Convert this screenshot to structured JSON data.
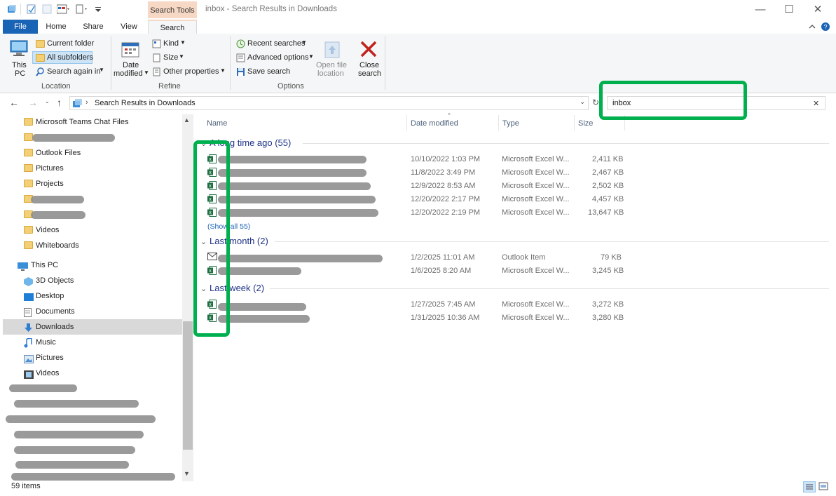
{
  "window": {
    "title": "inbox - Search Results in Downloads",
    "context_tab": "Search Tools",
    "controls": {
      "minimize": "—",
      "maximize": "☐",
      "close": "✕"
    }
  },
  "tabs": [
    "File",
    "Home",
    "Share",
    "View",
    "Search"
  ],
  "ribbon": {
    "location": {
      "this_pc_line1": "This",
      "this_pc_line2": "PC",
      "current_folder": "Current folder",
      "all_subfolders": "All subfolders",
      "search_again": "Search again in",
      "label": "Location"
    },
    "refine": {
      "date_line1": "Date",
      "date_line2": "modified",
      "kind": "Kind",
      "size": "Size",
      "other": "Other properties",
      "label": "Refine"
    },
    "options": {
      "recent": "Recent searches",
      "advanced": "Advanced options",
      "save": "Save search",
      "open_line1": "Open file",
      "open_line2": "location",
      "close_line1": "Close",
      "close_line2": "search",
      "label": "Options"
    }
  },
  "address": {
    "path": "Search Results in Downloads",
    "search_value": "inbox"
  },
  "nav": {
    "items": [
      {
        "label": "Microsoft Teams Chat Files",
        "icon": "folder-icon"
      },
      {
        "label": "",
        "icon": "folder-icon"
      },
      {
        "label": "Outlook Files",
        "icon": "folder-icon"
      },
      {
        "label": "Pictures",
        "icon": "folder-icon"
      },
      {
        "label": "Projects",
        "icon": "folder-icon"
      },
      {
        "label": "",
        "icon": "shared-folder-icon"
      },
      {
        "label": "",
        "icon": "shared-folder-icon"
      },
      {
        "label": "Videos",
        "icon": "folder-icon"
      },
      {
        "label": "Whiteboards",
        "icon": "folder-icon"
      }
    ],
    "this_pc": "This PC",
    "pc_items": [
      {
        "label": "3D Objects",
        "icon": "3d-objects-icon"
      },
      {
        "label": "Desktop",
        "icon": "desktop-icon"
      },
      {
        "label": "Documents",
        "icon": "documents-icon"
      },
      {
        "label": "Downloads",
        "icon": "downloads-icon"
      },
      {
        "label": "Music",
        "icon": "music-icon"
      },
      {
        "label": "Pictures",
        "icon": "pictures-icon"
      },
      {
        "label": "Videos",
        "icon": "videos-icon"
      }
    ]
  },
  "columns": {
    "name": "Name",
    "date": "Date modified",
    "type": "Type",
    "size": "Size"
  },
  "groups": [
    {
      "title": "A long time ago (55)",
      "show_all": "(Show all 55)",
      "rows": [
        {
          "date": "10/10/2022 1:03 PM",
          "type": "Microsoft Excel W...",
          "size": "2,411 KB",
          "icon": "excel-icon"
        },
        {
          "date": "11/8/2022 3:49 PM",
          "type": "Microsoft Excel W...",
          "size": "2,467 KB",
          "icon": "excel-icon"
        },
        {
          "date": "12/9/2022 8:53 AM",
          "type": "Microsoft Excel W...",
          "size": "2,502 KB",
          "icon": "excel-icon"
        },
        {
          "date": "12/20/2022 2:17 PM",
          "type": "Microsoft Excel W...",
          "size": "4,457 KB",
          "icon": "excel-icon"
        },
        {
          "date": "12/20/2022 2:19 PM",
          "type": "Microsoft Excel W...",
          "size": "13,647 KB",
          "icon": "excel-icon"
        }
      ]
    },
    {
      "title": "Last month (2)",
      "rows": [
        {
          "date": "1/2/2025 11:01 AM",
          "type": "Outlook Item",
          "size": "79 KB",
          "icon": "mail-icon"
        },
        {
          "date": "1/6/2025 8:20 AM",
          "type": "Microsoft Excel W...",
          "size": "3,245 KB",
          "icon": "excel-icon"
        }
      ]
    },
    {
      "title": "Last week (2)",
      "rows": [
        {
          "date": "1/27/2025 7:45 AM",
          "type": "Microsoft Excel W...",
          "size": "3,272 KB",
          "icon": "excel-icon"
        },
        {
          "date": "1/31/2025 10:36 AM",
          "type": "Microsoft Excel W...",
          "size": "3,280 KB",
          "icon": "excel-icon"
        }
      ]
    }
  ],
  "status": {
    "count": "59 items"
  },
  "colors": {
    "file_tab": "#1a64b5",
    "context_tab": "#f7d8c4",
    "group_text": "#1e3287",
    "highlight": "#00b04f",
    "selected_nav": "#d9d9d9"
  }
}
